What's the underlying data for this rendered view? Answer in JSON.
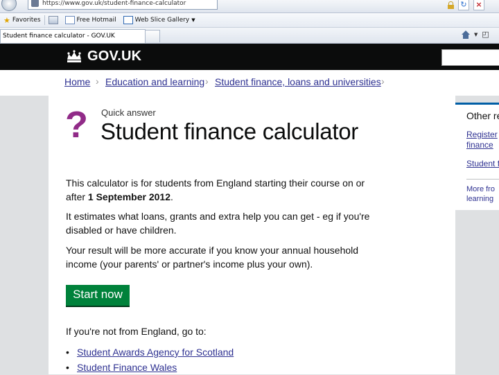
{
  "browser": {
    "address": "https://www.gov.uk/student-finance-calculator",
    "favorites_label": "Favorites",
    "favorites": [
      {
        "label": "Free Hotmail"
      },
      {
        "label": "Web Slice Gallery"
      }
    ],
    "tab_title": "Student finance calculator - GOV.UK"
  },
  "header": {
    "logo_text": "GOV.UK"
  },
  "breadcrumb": [
    "Home",
    "Education and learning",
    "Student finance, loans and universities"
  ],
  "main": {
    "label": "Quick answer",
    "title": "Student finance calculator",
    "intro_text": "This calculator is for students from England starting their course on or after ",
    "intro_date": "1 September 2012",
    "intro_end": ".",
    "estimate_text": "It estimates what loans, grants and extra help you can get - eg if you're disabled or have children.",
    "accuracy_text": "Your result will be more accurate if you know your annual household income (your parents' or partner's income plus your own).",
    "start_button": "Start now",
    "not_england": "If you're not from England, go to:",
    "links": [
      "Student Awards Agency for Scotland",
      "Student Finance Wales"
    ]
  },
  "related": {
    "title": "Other re",
    "link1_line1": "Register",
    "link1_line2": "finance",
    "link2": "Student f",
    "more_line1": "More fro",
    "more_line2": "learning"
  },
  "colors": {
    "header_bg": "#0b0c0c",
    "link": "#2e3191",
    "button": "#00823b",
    "question_mark": "#912b88"
  }
}
